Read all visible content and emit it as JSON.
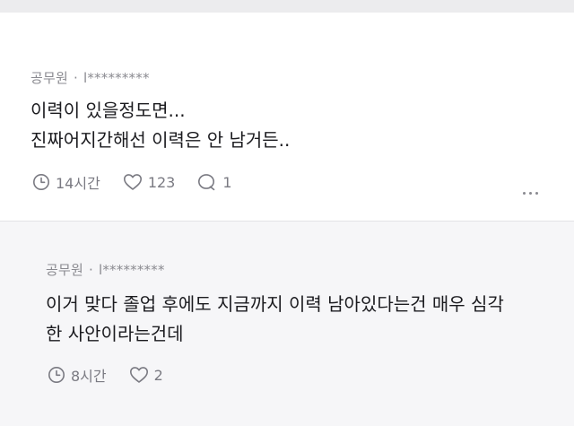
{
  "post": {
    "author": "공무원",
    "separator": "·",
    "handle": "l*********",
    "lines": [
      "이력이 있을정도면...",
      "진짜어지간해선 이력은 안 남거든.."
    ],
    "time": "14시간",
    "likes": "123",
    "comments": "1",
    "icons": [
      "clock-icon",
      "heart-icon",
      "comment-icon",
      "more-icon"
    ]
  },
  "reply": {
    "author": "공무원",
    "separator": "·",
    "handle": "l*********",
    "lines": [
      "이거 맞다 졸업 후에도 지금까지 이력 남아있다는건 매우 심각",
      "한 사안이라는건데"
    ],
    "time": "8시간",
    "likes": "2",
    "icons": [
      "clock-icon",
      "heart-icon"
    ]
  },
  "colors": {
    "text": "#1b1b1f",
    "meta": "#8a8a90",
    "reply_bg": "#f6f6f8",
    "top_bar": "#ececee"
  }
}
